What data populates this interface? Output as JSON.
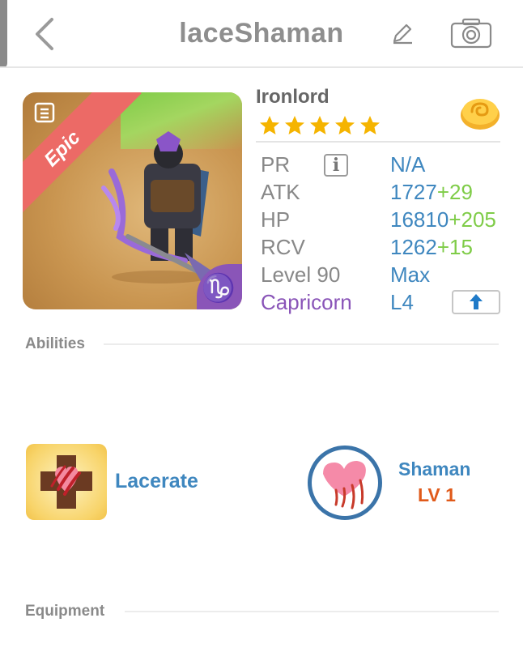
{
  "header": {
    "title": "laceShaman",
    "back_icon": "chevron-left-icon",
    "edit_icon": "pencil-icon",
    "camera_icon": "camera-icon"
  },
  "portrait": {
    "rarity": "Epic",
    "zodiac_glyph": "♑",
    "rarity_color": "#ec6a66",
    "zodiac_color": "#8a55b8"
  },
  "hero": {
    "name": "Ironlord",
    "stars": 5,
    "currency_icon": "gold-coin-icon"
  },
  "stats": {
    "pr_label": "PR",
    "pr_info": "i",
    "pr_value": "N/A",
    "atk_label": "ATK",
    "atk_value": "1727",
    "atk_bonus": "+29",
    "hp_label": "HP",
    "hp_value": "16810",
    "hp_bonus": "+205",
    "rcv_label": "RCV",
    "rcv_value": "1262",
    "rcv_bonus": "+15",
    "level_label": "Level 90",
    "level_value": "Max",
    "zodiac_label": "Capricorn",
    "zodiac_level": "L4",
    "upgrade_icon": "arrow-up-icon"
  },
  "sections": {
    "abilities": "Abilities",
    "equipment": "Equipment"
  },
  "abilities": {
    "skill_name": "Lacerate",
    "class_name": "Shaman",
    "class_level": "LV 1"
  },
  "colors": {
    "accent_blue": "#3f87bf",
    "bonus_green": "#7fcc48",
    "level_orange": "#e05a1a",
    "star_gold": "#f5b400"
  }
}
